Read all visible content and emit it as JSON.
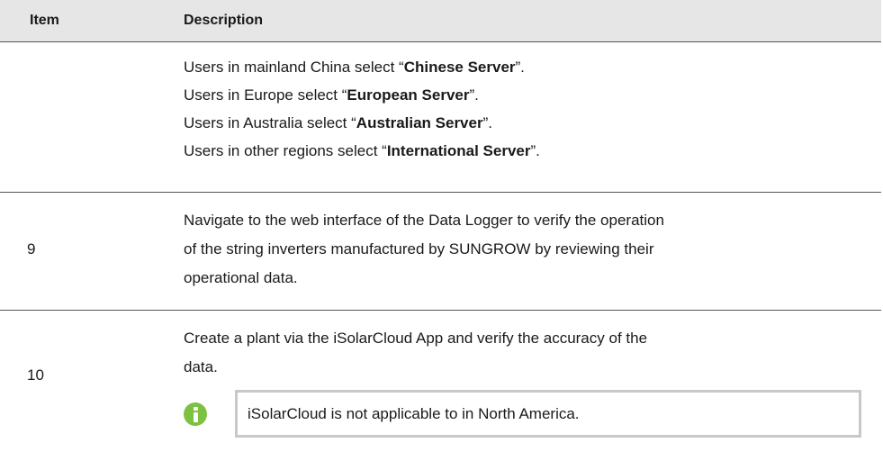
{
  "table": {
    "headers": {
      "item": "Item",
      "description": "Description"
    },
    "server_row": {
      "lines": [
        {
          "prefix": "Users in mainland China select “",
          "bold": "Chinese Server",
          "suffix": "”."
        },
        {
          "prefix": "Users in Europe select “",
          "bold": "European Server",
          "suffix": "”."
        },
        {
          "prefix": "Users in Australia select “",
          "bold": "Australian Server",
          "suffix": "”."
        },
        {
          "prefix": "Users in other regions select “",
          "bold": "International Server",
          "suffix": "”."
        }
      ]
    },
    "row_9": {
      "item": "9",
      "lines": [
        "Navigate to the web interface of the Data Logger to verify the operation",
        "of the string inverters manufactured by SUNGROW by reviewing their",
        "operational data."
      ]
    },
    "row_10": {
      "item": "10",
      "lines": [
        "Create a plant via the iSolarCloud App and verify the accuracy of the",
        "data."
      ],
      "note": {
        "icon": "info-icon",
        "icon_color": "#7dc142",
        "text": "iSolarCloud is not applicable to in North America."
      }
    }
  }
}
